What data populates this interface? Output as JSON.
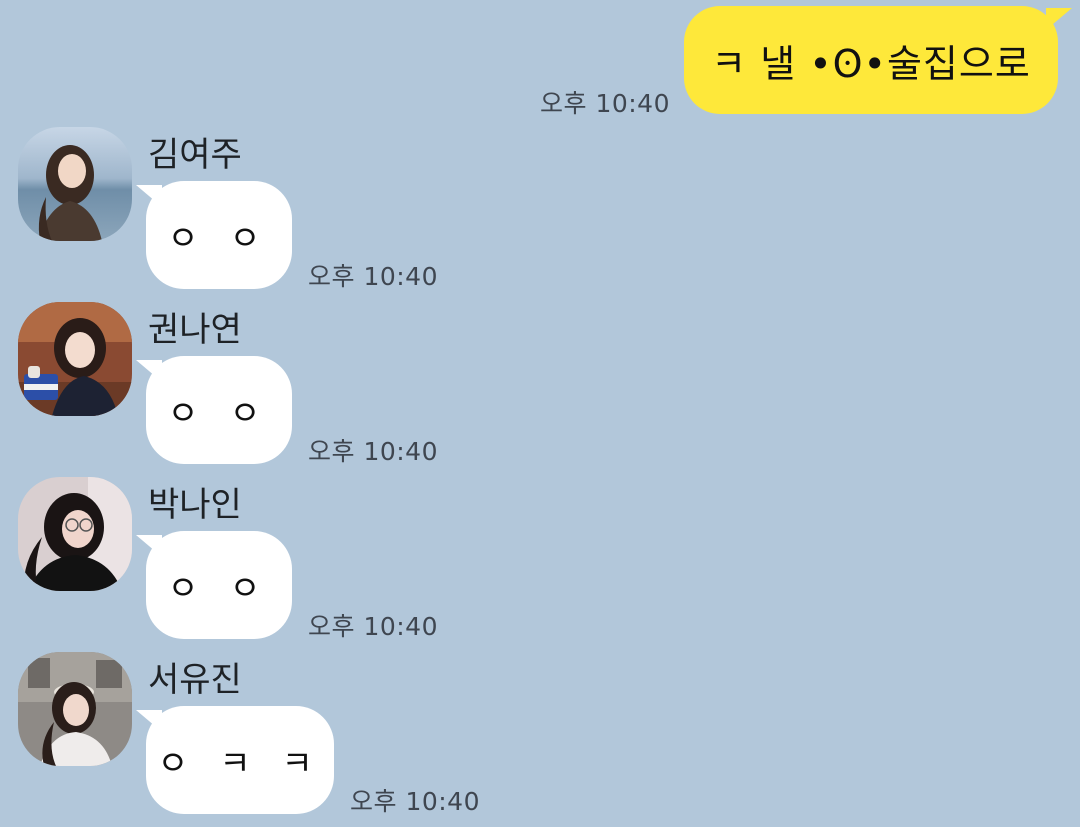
{
  "outgoing": {
    "text": "ㅋ 낼 •ʘ•술집으로",
    "time": "오후 10:40"
  },
  "messages": [
    {
      "sender": "김여주",
      "text": "ㅇ ㅇ",
      "time": "오후 10:40",
      "avatar_icon": "profile-photo-icon"
    },
    {
      "sender": "권나연",
      "text": "ㅇ ㅇ",
      "time": "오후 10:40",
      "avatar_icon": "profile-photo-icon"
    },
    {
      "sender": "박나인",
      "text": "ㅇ ㅇ",
      "time": "오후 10:40",
      "avatar_icon": "profile-photo-icon"
    },
    {
      "sender": "서유진",
      "text": "ㅇ ㅋ ㅋ",
      "time": "오후 10:40",
      "avatar_icon": "profile-photo-icon"
    }
  ],
  "colors": {
    "background": "#b2c7da",
    "outgoing_bubble": "#fee83a",
    "incoming_bubble": "#ffffff"
  }
}
